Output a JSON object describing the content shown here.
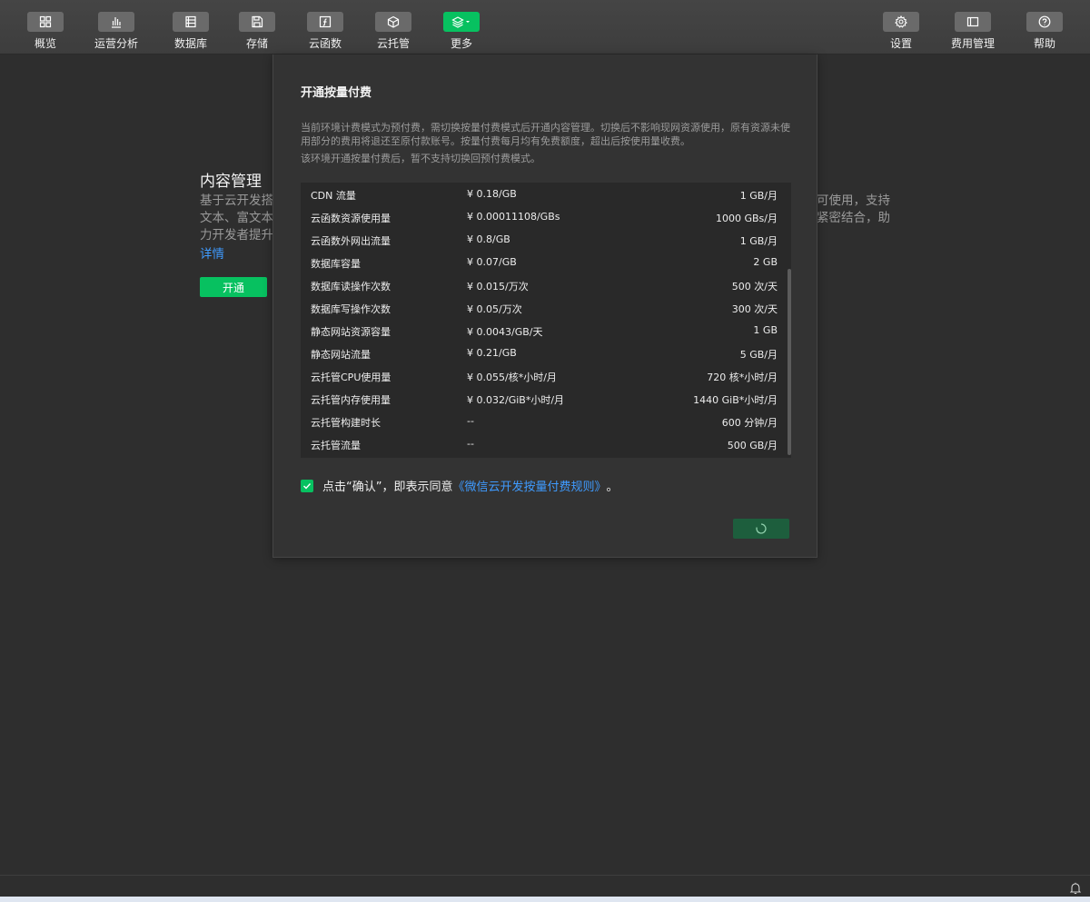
{
  "toolbar": {
    "left_items": [
      {
        "label": "概览",
        "icon": "grid-icon"
      },
      {
        "label": "运营分析",
        "icon": "bar-chart-icon"
      },
      {
        "label": "数据库",
        "icon": "database-icon"
      },
      {
        "label": "存储",
        "icon": "storage-icon"
      },
      {
        "label": "云函数",
        "icon": "function-icon"
      },
      {
        "label": "云托管",
        "icon": "cube-icon"
      },
      {
        "label": "更多",
        "icon": "layers-icon"
      }
    ],
    "right_items": [
      {
        "label": "设置",
        "icon": "gear-icon"
      },
      {
        "label": "费用管理",
        "icon": "billing-icon"
      },
      {
        "label": "帮助",
        "icon": "help-icon"
      }
    ]
  },
  "page": {
    "title": "内容管理",
    "desc_left": [
      "基于云开发搭",
      "文本、富文本",
      "力开发者提升"
    ],
    "desc_right": [
      "可使用，支持",
      "紧密结合，助"
    ],
    "detail_link": "详情",
    "open_button": "开通"
  },
  "modal": {
    "title": "开通按量付费",
    "note_1": "当前环境计费模式为预付费，需切换按量付费模式后开通内容管理。切换后不影响现网资源使用，原有资源未使用部分的费用将退还至原付款账号。按量付费每月均有免费额度，超出后按使用量收费。",
    "note_2": "该环境开通按量付费后，暂不支持切换回预付费模式。",
    "rows": [
      {
        "name": "CDN 流量",
        "price": "¥ 0.18/GB",
        "free": "1 GB/月"
      },
      {
        "name": "云函数资源使用量",
        "price": "¥ 0.00011108/GBs",
        "free": "1000 GBs/月"
      },
      {
        "name": "云函数外网出流量",
        "price": "¥ 0.8/GB",
        "free": "1 GB/月"
      },
      {
        "name": "数据库容量",
        "price": "¥ 0.07/GB",
        "free": "2 GB"
      },
      {
        "name": "数据库读操作次数",
        "price": "¥ 0.015/万次",
        "free": "500 次/天"
      },
      {
        "name": "数据库写操作次数",
        "price": "¥ 0.05/万次",
        "free": "300 次/天"
      },
      {
        "name": "静态网站资源容量",
        "price": "¥ 0.0043/GB/天",
        "free": "1 GB"
      },
      {
        "name": "静态网站流量",
        "price": "¥ 0.21/GB",
        "free": "5 GB/月"
      },
      {
        "name": "云托管CPU使用量",
        "price": "¥ 0.055/核*小时/月",
        "free": "720 核*小时/月"
      },
      {
        "name": "云托管内存使用量",
        "price": "¥ 0.032/GiB*小时/月",
        "free": "1440 GiB*小时/月"
      },
      {
        "name": "云托管构建时长",
        "price": "--",
        "free": "600 分钟/月"
      },
      {
        "name": "云托管流量",
        "price": "--",
        "free": "500 GB/月"
      }
    ],
    "agree_text": "点击“确认”，即表示同意",
    "agree_link": "《微信云开发按量付费规则》",
    "agree_end": "。",
    "agree_checked": true
  },
  "colors": {
    "accent": "#07c160",
    "link": "#3f9bff",
    "background": "#2e2e2e",
    "modal": "#333333"
  }
}
